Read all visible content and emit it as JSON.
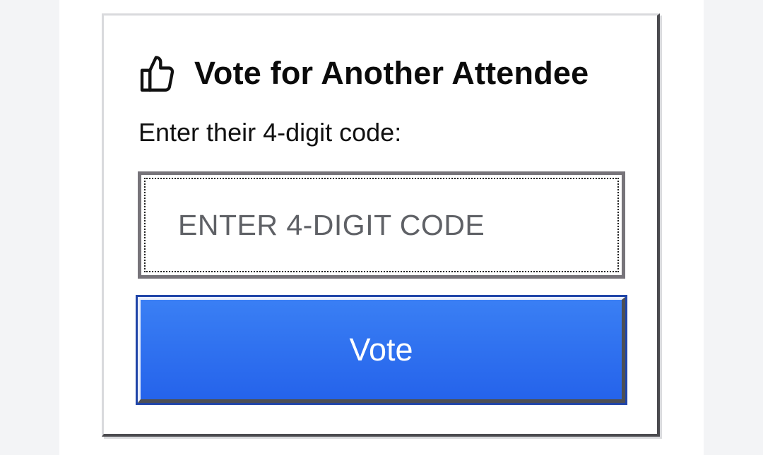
{
  "card": {
    "title": "Vote for Another Attendee",
    "icon": "thumbs-up-icon",
    "prompt": "Enter their 4-digit code:",
    "code_input": {
      "placeholder": "ENTER 4-DIGIT CODE",
      "value": ""
    },
    "vote_button_label": "Vote"
  },
  "colors": {
    "button_blue": "#2563eb",
    "button_border": "#2045a8",
    "input_border": "#77747a"
  }
}
